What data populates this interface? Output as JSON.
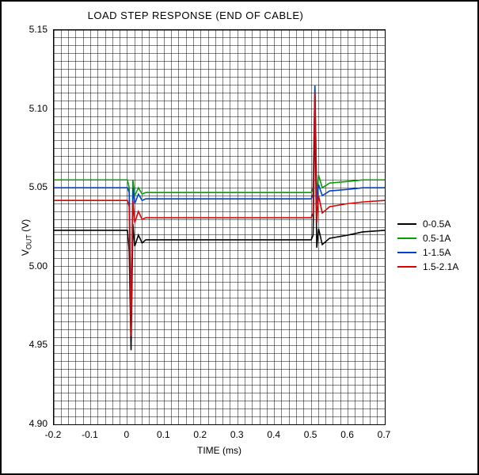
{
  "chart_data": {
    "type": "line",
    "title": "LOAD STEP RESPONSE (END OF CABLE)",
    "xlabel": "TIME (ms)",
    "ylabel": "VOUT (V)",
    "xlim": [
      -0.2,
      0.7
    ],
    "ylim": [
      4.9,
      5.15
    ],
    "xticks": [
      -0.2,
      -0.1,
      0,
      0.1,
      0.2,
      0.3,
      0.4,
      0.5,
      0.6,
      0.7
    ],
    "yticks": [
      4.9,
      4.95,
      5.0,
      5.05,
      5.1,
      5.15
    ],
    "legend_position": "right",
    "grid": "minor",
    "series": [
      {
        "name": "0-0.5A",
        "color": "#000000",
        "x": [
          -0.2,
          0.0,
          0.005,
          0.01,
          0.015,
          0.02,
          0.03,
          0.04,
          0.05,
          0.1,
          0.5,
          0.505,
          0.51,
          0.515,
          0.52,
          0.53,
          0.55,
          0.6,
          0.64,
          0.7
        ],
        "y": [
          5.023,
          5.023,
          5.01,
          4.947,
          5.027,
          5.013,
          5.02,
          5.015,
          5.017,
          5.017,
          5.017,
          5.02,
          5.1,
          5.012,
          5.024,
          5.014,
          5.018,
          5.02,
          5.022,
          5.023
        ]
      },
      {
        "name": "0.5-1A",
        "color": "#00a000",
        "x": [
          -0.2,
          0.0,
          0.005,
          0.01,
          0.015,
          0.02,
          0.03,
          0.04,
          0.05,
          0.1,
          0.5,
          0.505,
          0.51,
          0.515,
          0.52,
          0.53,
          0.55,
          0.6,
          0.64,
          0.7
        ],
        "y": [
          5.055,
          5.055,
          5.05,
          4.963,
          5.055,
          5.045,
          5.05,
          5.046,
          5.047,
          5.047,
          5.047,
          5.05,
          5.113,
          5.045,
          5.058,
          5.05,
          5.053,
          5.054,
          5.055,
          5.055
        ]
      },
      {
        "name": "1-1.5A",
        "color": "#0040d0",
        "x": [
          -0.2,
          0.0,
          0.005,
          0.01,
          0.015,
          0.02,
          0.03,
          0.04,
          0.05,
          0.1,
          0.5,
          0.505,
          0.51,
          0.515,
          0.52,
          0.53,
          0.55,
          0.6,
          0.64,
          0.7
        ],
        "y": [
          5.05,
          5.05,
          5.047,
          4.961,
          5.05,
          5.04,
          5.046,
          5.042,
          5.043,
          5.043,
          5.043,
          5.046,
          5.115,
          5.04,
          5.052,
          5.045,
          5.048,
          5.049,
          5.05,
          5.05
        ]
      },
      {
        "name": "1.5-2.1A",
        "color": "#e00000",
        "x": [
          -0.2,
          0.0,
          0.005,
          0.01,
          0.015,
          0.02,
          0.03,
          0.04,
          0.05,
          0.1,
          0.5,
          0.505,
          0.51,
          0.515,
          0.52,
          0.53,
          0.55,
          0.6,
          0.64,
          0.7
        ],
        "y": [
          5.042,
          5.042,
          5.038,
          4.956,
          5.042,
          5.028,
          5.035,
          5.03,
          5.031,
          5.031,
          5.031,
          5.034,
          5.11,
          5.028,
          5.045,
          5.034,
          5.038,
          5.04,
          5.041,
          5.042
        ]
      }
    ]
  }
}
